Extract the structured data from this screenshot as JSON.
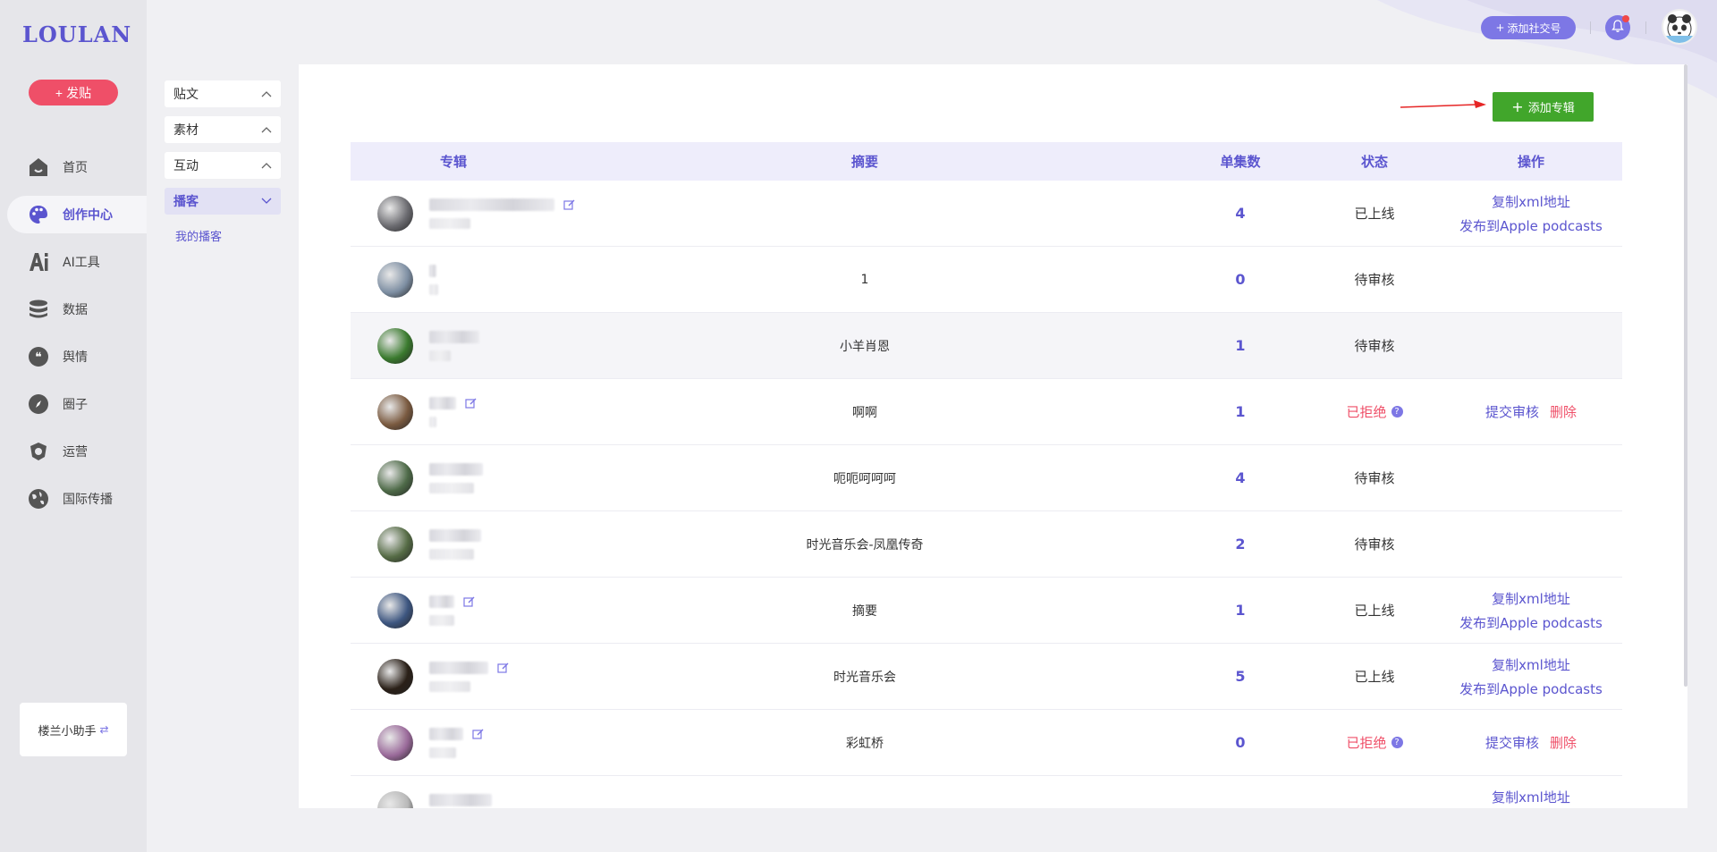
{
  "sidebar": {
    "logo": "LOULAN",
    "post_label": "发贴",
    "items": [
      {
        "label": "首页"
      },
      {
        "label": "创作中心"
      },
      {
        "label": "AI工具"
      },
      {
        "label": "数据"
      },
      {
        "label": "舆情"
      },
      {
        "label": "圈子"
      },
      {
        "label": "运营"
      },
      {
        "label": "国际传播"
      }
    ],
    "active_index": 1,
    "helper_label": "楼兰小助手"
  },
  "subnav": {
    "items": [
      {
        "label": "贴文"
      },
      {
        "label": "素材"
      },
      {
        "label": "互动"
      },
      {
        "label": "播客"
      }
    ],
    "active_index": 3,
    "sub_link": "我的播客"
  },
  "header": {
    "add_social_label": "添加社交号"
  },
  "main": {
    "add_album_label": "添加专辑",
    "columns": [
      "专辑",
      "摘要",
      "单集数",
      "状态",
      "操作"
    ],
    "action_labels": {
      "copy_xml": "复制xml地址",
      "publish_apple": "发布到Apple podcasts",
      "submit_review": "提交审核",
      "delete": "删除"
    },
    "rows": [
      {
        "abstract": "",
        "count": "4",
        "status": "已上线",
        "rejected": false,
        "ops": "online",
        "thumb_color": "#6b6b70",
        "edit": true
      },
      {
        "abstract": "1",
        "count": "0",
        "status": "待审核",
        "rejected": false,
        "ops": "none",
        "thumb_color": "#7e8fa3",
        "edit": false
      },
      {
        "abstract": "小羊肖恩",
        "count": "1",
        "status": "待审核",
        "rejected": false,
        "ops": "none",
        "thumb_color": "#3a7a2e",
        "edit": false
      },
      {
        "abstract": "啊啊",
        "count": "1",
        "status": "已拒绝",
        "rejected": true,
        "ops": "rejected",
        "thumb_color": "#7a5a40",
        "edit": true
      },
      {
        "abstract": "呃呃呵呵呵",
        "count": "4",
        "status": "待审核",
        "rejected": false,
        "ops": "none",
        "thumb_color": "#4e6a48",
        "edit": false
      },
      {
        "abstract": "时光音乐会-凤凰传奇",
        "count": "2",
        "status": "待审核",
        "rejected": false,
        "ops": "none",
        "thumb_color": "#556b45",
        "edit": false
      },
      {
        "abstract": "摘要",
        "count": "1",
        "status": "已上线",
        "rejected": false,
        "ops": "online",
        "thumb_color": "#3d5680",
        "edit": true
      },
      {
        "abstract": "时光音乐会",
        "count": "5",
        "status": "已上线",
        "rejected": false,
        "ops": "online",
        "thumb_color": "#2a2018",
        "edit": true
      },
      {
        "abstract": "彩虹桥",
        "count": "0",
        "status": "已拒绝",
        "rejected": true,
        "ops": "rejected",
        "thumb_color": "#9a6a9a",
        "edit": true
      },
      {
        "abstract": "",
        "count": "",
        "status": "",
        "rejected": false,
        "ops": "online",
        "thumb_color": "#b8b8b8",
        "edit": false
      }
    ]
  },
  "colors": {
    "accent": "#5b55cf",
    "accent_light": "#7d77e5",
    "danger": "#ef4f68",
    "success": "#41a62b"
  }
}
